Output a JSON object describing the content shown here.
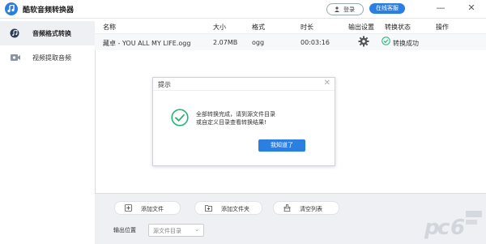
{
  "app": {
    "title": "酷软音频转换器"
  },
  "header": {
    "login_label": "登录",
    "service_label": "在线客服"
  },
  "sidebar": {
    "items": [
      {
        "label": "音频格式转换"
      },
      {
        "label": "视频提取音频"
      }
    ]
  },
  "table": {
    "columns": [
      "名称",
      "大小",
      "格式",
      "时长",
      "输出设置",
      "转换状态",
      "操作"
    ],
    "rows": [
      {
        "name": "藏卓 - YOU ALL MY LIFE.ogg",
        "size": "2.07MB",
        "format": "ogg",
        "duration": "00:03:16",
        "status": "转换成功"
      }
    ]
  },
  "footer": {
    "add_file": "添加文件",
    "add_folder": "添加文件夹",
    "clear_list": "清空列表",
    "output_label": "输出位置",
    "output_value": "源文件目录"
  },
  "dialog": {
    "title": "提示",
    "line1": "全部转换完成，请到源文件目录",
    "line2": "或自定义目录查看转换结果!",
    "ok_label": "我知道了"
  },
  "colors": {
    "accent": "#2b7fe0",
    "success": "#22b573"
  },
  "icons": [
    "app-logo-icon",
    "user-icon",
    "minimize-icon",
    "close-icon",
    "music-icon",
    "video-icon",
    "gear-icon",
    "success-icon",
    "add-file-icon",
    "add-folder-icon",
    "clear-list-icon",
    "check-circle-icon"
  ]
}
